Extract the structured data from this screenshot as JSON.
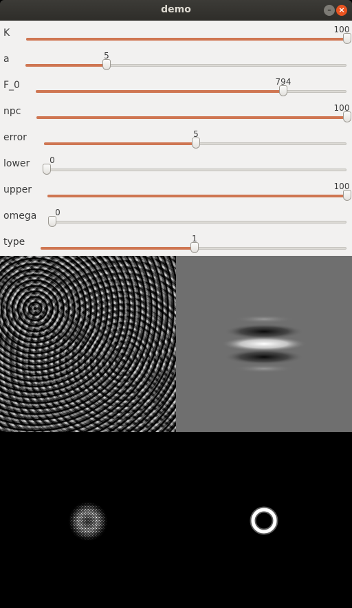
{
  "window": {
    "title": "demo",
    "minimize_icon": "minimize-icon",
    "close_icon": "close-icon"
  },
  "trackbars": [
    {
      "label": "K",
      "value": "100",
      "fraction": 1.0
    },
    {
      "label": "a",
      "value": "5",
      "fraction": 0.25
    },
    {
      "label": "F_0",
      "value": "794",
      "fraction": 0.794
    },
    {
      "label": "npc",
      "value": "100",
      "fraction": 1.0
    },
    {
      "label": "error",
      "value": "5",
      "fraction": 0.5
    },
    {
      "label": "lower",
      "value": "0",
      "fraction": 0.0
    },
    {
      "label": "upper",
      "value": "100",
      "fraction": 1.0
    },
    {
      "label": "omega",
      "value": "0",
      "fraction": 0.0
    },
    {
      "label": "type",
      "value": "1",
      "fraction": 0.5
    }
  ],
  "colors": {
    "accent": "#cf7652",
    "titlebar": "#2e2d29",
    "close": "#e95420",
    "panel": "#f2f1f0"
  },
  "images": {
    "top_left": "filtered-noise-texture",
    "top_right": "gabor-kernel",
    "bottom_left": "noise-spectrum",
    "bottom_right": "kernel-spectrum-ring"
  }
}
